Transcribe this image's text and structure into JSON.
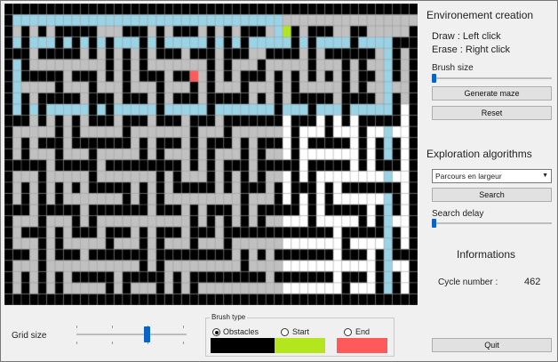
{
  "grid": {
    "maze_rows": [
      "1111111111111111111111111111111111111111111111111",
      "10000000000000000000000000000000000000000000000000",
      "1010101111100011101011101010111001101110011000001",
      "1010001010101000101000001010100000101000010000111",
      "1110111110101010101110111011100111101011111100101",
      "1010000000001010100000001010001000001000101000101",
      "1011111011101010111011101010111010101010101100101",
      "1000001000100010001000101000100010100000101000001",
      "1010111110111011101011101111101010111110111100101",
      "1010100000101000001000001000000010001000100000101",
      "1110101010111011101110111011111110111010101111101",
      "1000001010000010000000100010000000100010001000001",
      "1010111011111110101110101110101110101111101010101",
      "1010001000100000101000101000101000100000001010101",
      "1111101111101111111110101011101111101111101011101",
      "1000100000100000001010001010101000101000000000001",
      "1010101010111110101011111010111010111010111111101",
      "1010101000000010101000000000100010101010000000101",
      "1110111110111111101110101110101111101011111010101",
      "1000100010100000000000101010101000001000001010001",
      "1011101011101110101110111011111111111110111110101",
      "1000101000001000101000100010000000000000100000101",
      "1110101110111111101111111110101011111110111010111",
      "1000100000000000101000000000100000000000000010001",
      "1010101011111011111010111111111011111110111010101",
      "1010101000001010001010100000000000000000100010101",
      "1111111111111111111111111111111111111111111111111"
    ],
    "path_cells": [
      [
        1,
        1
      ],
      [
        1,
        2
      ],
      [
        1,
        3
      ],
      [
        1,
        4
      ],
      [
        1,
        5
      ],
      [
        1,
        6
      ],
      [
        1,
        7
      ],
      [
        1,
        8
      ],
      [
        1,
        9
      ],
      [
        1,
        10
      ],
      [
        1,
        11
      ],
      [
        1,
        12
      ],
      [
        1,
        13
      ],
      [
        1,
        14
      ],
      [
        1,
        15
      ],
      [
        1,
        16
      ],
      [
        1,
        17
      ],
      [
        1,
        18
      ],
      [
        1,
        19
      ],
      [
        1,
        20
      ],
      [
        1,
        21
      ],
      [
        1,
        22
      ],
      [
        1,
        23
      ],
      [
        1,
        24
      ],
      [
        1,
        25
      ],
      [
        1,
        26
      ],
      [
        1,
        27
      ],
      [
        1,
        28
      ],
      [
        1,
        29
      ],
      [
        1,
        30
      ],
      [
        1,
        31
      ],
      [
        1,
        32
      ],
      [
        2,
        32
      ],
      [
        3,
        32
      ],
      [
        3,
        31
      ],
      [
        3,
        30
      ],
      [
        3,
        29
      ],
      [
        3,
        28
      ],
      [
        3,
        27
      ],
      [
        3,
        26
      ],
      [
        3,
        25
      ],
      [
        3,
        24
      ],
      [
        3,
        23
      ],
      [
        3,
        22
      ],
      [
        3,
        21
      ],
      [
        3,
        20
      ],
      [
        3,
        19
      ],
      [
        3,
        18
      ],
      [
        3,
        17
      ],
      [
        3,
        16
      ],
      [
        3,
        15
      ],
      [
        3,
        14
      ],
      [
        3,
        13
      ],
      [
        3,
        12
      ],
      [
        3,
        11
      ],
      [
        3,
        10
      ],
      [
        3,
        9
      ],
      [
        3,
        8
      ],
      [
        3,
        7
      ],
      [
        3,
        6
      ],
      [
        3,
        5
      ],
      [
        3,
        4
      ],
      [
        3,
        3
      ],
      [
        3,
        2
      ],
      [
        3,
        1
      ],
      [
        4,
        1
      ],
      [
        5,
        1
      ],
      [
        6,
        1
      ],
      [
        7,
        1
      ],
      [
        8,
        1
      ],
      [
        9,
        1
      ],
      [
        9,
        2
      ],
      [
        9,
        3
      ],
      [
        9,
        4
      ],
      [
        9,
        5
      ],
      [
        9,
        6
      ],
      [
        9,
        7
      ],
      [
        9,
        8
      ],
      [
        9,
        9
      ],
      [
        9,
        10
      ],
      [
        9,
        11
      ],
      [
        9,
        12
      ],
      [
        9,
        13
      ],
      [
        9,
        14
      ],
      [
        9,
        15
      ],
      [
        9,
        16
      ],
      [
        9,
        17
      ],
      [
        9,
        18
      ],
      [
        9,
        19
      ],
      [
        9,
        20
      ],
      [
        9,
        21
      ],
      [
        9,
        22
      ],
      [
        9,
        23
      ],
      [
        9,
        24
      ],
      [
        9,
        25
      ],
      [
        9,
        26
      ],
      [
        9,
        27
      ],
      [
        9,
        28
      ],
      [
        9,
        29
      ],
      [
        9,
        30
      ],
      [
        9,
        31
      ],
      [
        9,
        32
      ],
      [
        9,
        33
      ],
      [
        9,
        34
      ],
      [
        9,
        35
      ],
      [
        9,
        36
      ],
      [
        9,
        37
      ],
      [
        9,
        38
      ],
      [
        9,
        39
      ],
      [
        9,
        40
      ],
      [
        9,
        41
      ],
      [
        9,
        42
      ],
      [
        9,
        43
      ],
      [
        9,
        44
      ],
      [
        9,
        45
      ],
      [
        8,
        45
      ],
      [
        7,
        45
      ],
      [
        6,
        45
      ],
      [
        5,
        45
      ],
      [
        4,
        45
      ],
      [
        3,
        45
      ],
      [
        3,
        44
      ],
      [
        3,
        43
      ],
      [
        3,
        42
      ],
      [
        3,
        41
      ],
      [
        3,
        40
      ],
      [
        3,
        39
      ],
      [
        3,
        38
      ],
      [
        3,
        37
      ],
      [
        3,
        36
      ],
      [
        3,
        35
      ],
      [
        3,
        34
      ],
      [
        3,
        33
      ],
      [
        10,
        45
      ],
      [
        11,
        45
      ],
      [
        12,
        45
      ],
      [
        13,
        45
      ],
      [
        14,
        45
      ],
      [
        15,
        45
      ],
      [
        16,
        45
      ],
      [
        17,
        45
      ],
      [
        18,
        45
      ],
      [
        19,
        45
      ],
      [
        20,
        45
      ],
      [
        21,
        45
      ],
      [
        22,
        45
      ],
      [
        23,
        45
      ],
      [
        24,
        45
      ],
      [
        25,
        45
      ],
      [
        26,
        45
      ]
    ],
    "white_region": {
      "col_start": 33,
      "row_start": 9,
      "col_end": 48,
      "row_end": 26
    },
    "start_cell": [
      2,
      33
    ],
    "end_cell": [
      6,
      22
    ]
  },
  "panel": {
    "env_title": "Environement creation",
    "draw_hint": "Draw : Left click",
    "erase_hint": "Erase : Right click",
    "brush_size_label": "Brush size",
    "brush_size_value": 0,
    "generate_button": "Generate maze",
    "reset_button": "Reset",
    "algo_title": "Exploration algorithms",
    "algo_selected": "Parcours en largeur",
    "search_button": "Search",
    "search_delay_label": "Search delay",
    "search_delay_value": 0,
    "info_title": "Informations",
    "cycle_label": "Cycle number :",
    "cycle_value": "462",
    "quit_button": "Quit"
  },
  "bottom": {
    "grid_size_label": "Grid size",
    "grid_size_value": 0.65,
    "brush_type_title": "Brush type",
    "brush_types": [
      {
        "label": "Obstacles",
        "color": "#000000",
        "selected": true
      },
      {
        "label": "Start",
        "color": "#b4e61e",
        "selected": false
      },
      {
        "label": "End",
        "color": "#ff5a5a",
        "selected": false
      }
    ]
  },
  "colors": {
    "wall": "#000000",
    "visited": "#c0c0c0",
    "path": "#9ad3e6",
    "free": "#ffffff",
    "start": "#b4e61e",
    "end": "#ff5a5a",
    "grid_line": "#8a8a8a"
  }
}
